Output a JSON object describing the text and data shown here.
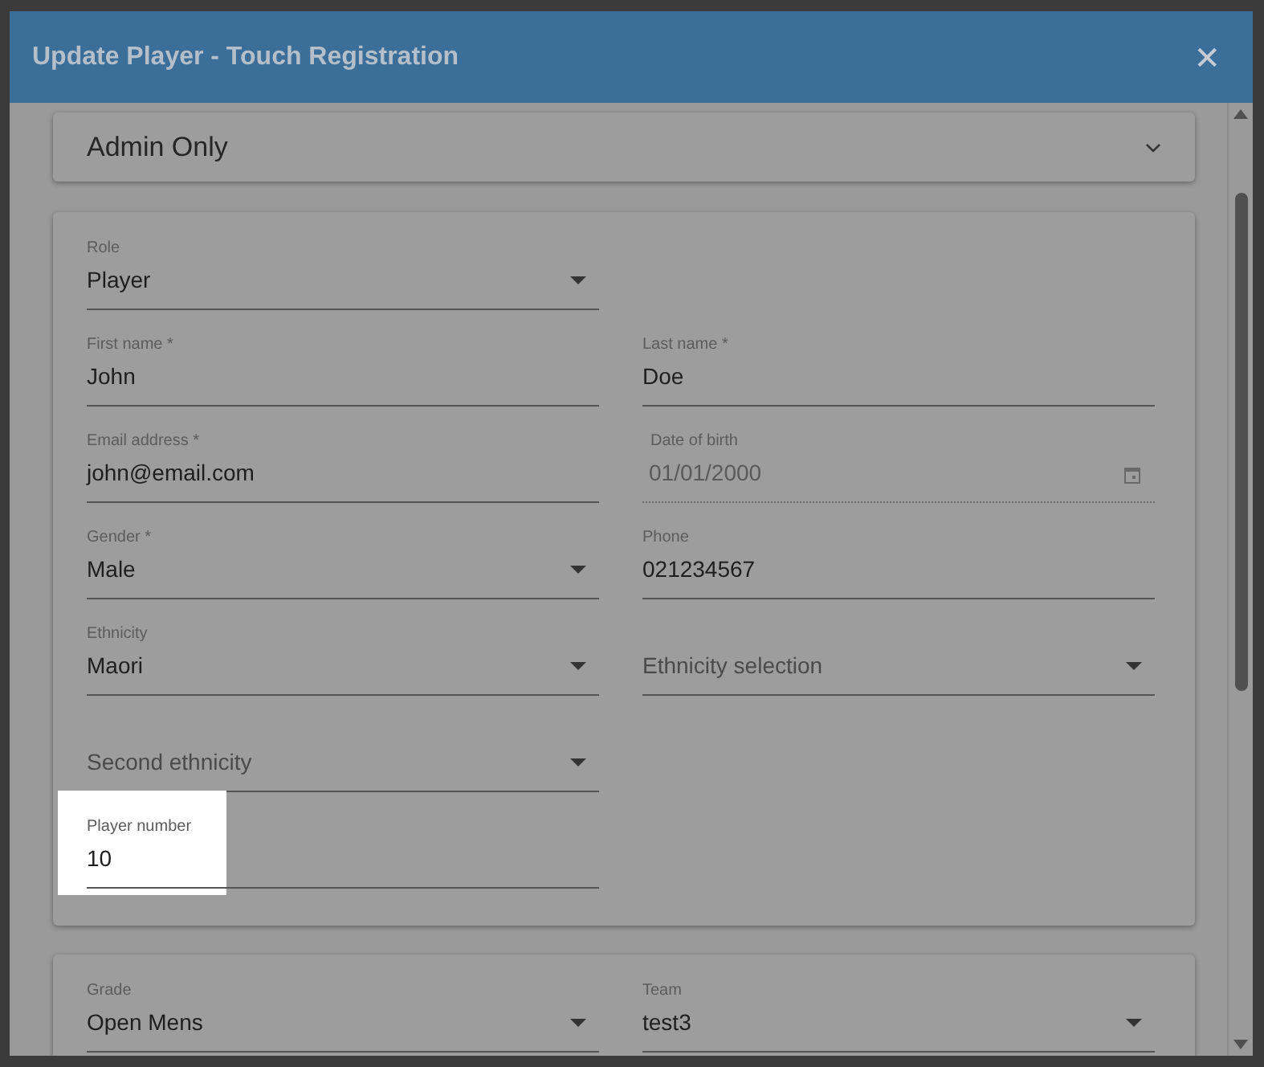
{
  "dialog": {
    "title": "Update Player - Touch Registration",
    "close_label": "✕"
  },
  "admin_panel": {
    "title": "Admin Only",
    "expanded": false
  },
  "sections": [
    {
      "rows": [
        [
          {
            "kind": "select",
            "label": "Role",
            "value": "Player"
          }
        ],
        [
          {
            "kind": "text",
            "label": "First name *",
            "value": "John"
          },
          {
            "kind": "text",
            "label": "Last name *",
            "value": "Doe"
          }
        ],
        [
          {
            "kind": "text",
            "label": "Email address *",
            "value": "john@email.com"
          },
          {
            "kind": "date",
            "label": "Date of birth",
            "value": "01/01/2000",
            "disabled": true
          }
        ],
        [
          {
            "kind": "select",
            "label": "Gender *",
            "value": "Male"
          },
          {
            "kind": "text",
            "label": "Phone",
            "value": "021234567"
          }
        ],
        [
          {
            "kind": "select",
            "label": "Ethnicity",
            "value": "Maori"
          },
          {
            "kind": "select",
            "placeholder": "Ethnicity selection"
          }
        ],
        [
          {
            "kind": "select",
            "placeholder": "Second ethnicity"
          }
        ],
        [
          {
            "kind": "text",
            "label": "Player number",
            "value": "10",
            "highlighted": true
          }
        ]
      ]
    },
    {
      "rows": [
        [
          {
            "kind": "select",
            "label": "Grade",
            "value": "Open Mens"
          },
          {
            "kind": "select",
            "label": "Team",
            "value": "test3"
          }
        ]
      ]
    }
  ]
}
